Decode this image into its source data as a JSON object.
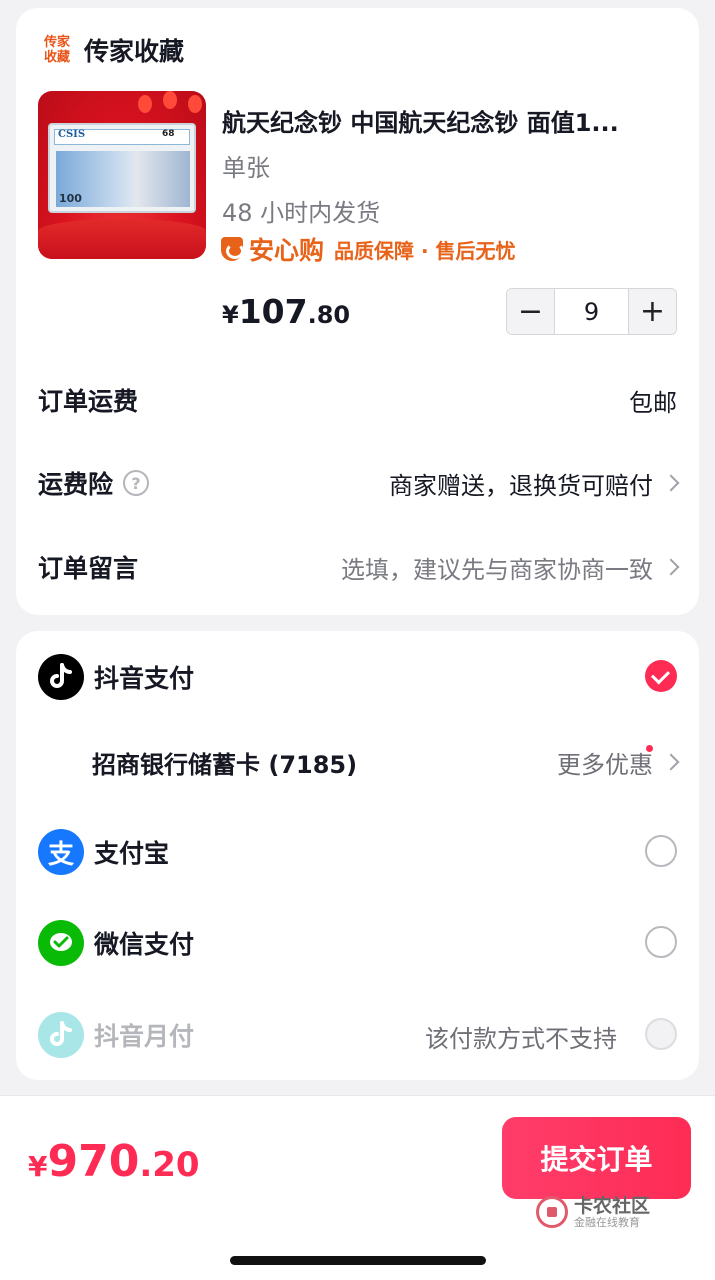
{
  "store": {
    "logo_text": "传家收藏",
    "name": "传家收藏"
  },
  "product": {
    "image_text": {
      "slab_brand": "CSIS",
      "grade": "68",
      "note_value": "100"
    },
    "title": "航天纪念钞 中国航天纪念钞  面值1...",
    "spec": "单张",
    "shipping_time": "48 小时内发货",
    "assurance_brand": "安心购",
    "assurance_text": "品质保障 · 售后无忧",
    "price_symbol": "¥",
    "price_int": "107",
    "price_dec": ".80",
    "quantity": "9",
    "minus": "−",
    "plus": "+"
  },
  "order_rows": {
    "freight_label": "订单运费",
    "freight_value": "包邮",
    "insurance_label": "运费险",
    "insurance_help": "?",
    "insurance_value": "商家赠送，退换货可赔付",
    "note_label": "订单留言",
    "note_placeholder": "选填，建议先与商家协商一致"
  },
  "payment": {
    "douyin_pay": {
      "label": "抖音支付",
      "icon": "douyin-icon",
      "selected": true
    },
    "bank_card": {
      "label": "招商银行储蓄卡 (7185)",
      "more": "更多优惠"
    },
    "alipay": {
      "label": "支付宝",
      "icon_glyph": "支",
      "icon": "alipay-icon"
    },
    "wechat": {
      "label": "微信支付",
      "icon": "wechat-pay-icon"
    },
    "monthly": {
      "label": "抖音月付",
      "icon": "douyin-icon",
      "status": "该付款方式不支持"
    }
  },
  "footer": {
    "total_symbol": "¥",
    "total_int": "970",
    "total_dec": ".20",
    "submit_label": "提交订单"
  },
  "watermark": {
    "main": "卡农社区",
    "sub": "金融在线教育"
  },
  "colors": {
    "accent": "#fe2c55",
    "assurance": "#e8631a",
    "alipay": "#1677ff",
    "wechat": "#09bb07",
    "douyin": "#000000"
  }
}
